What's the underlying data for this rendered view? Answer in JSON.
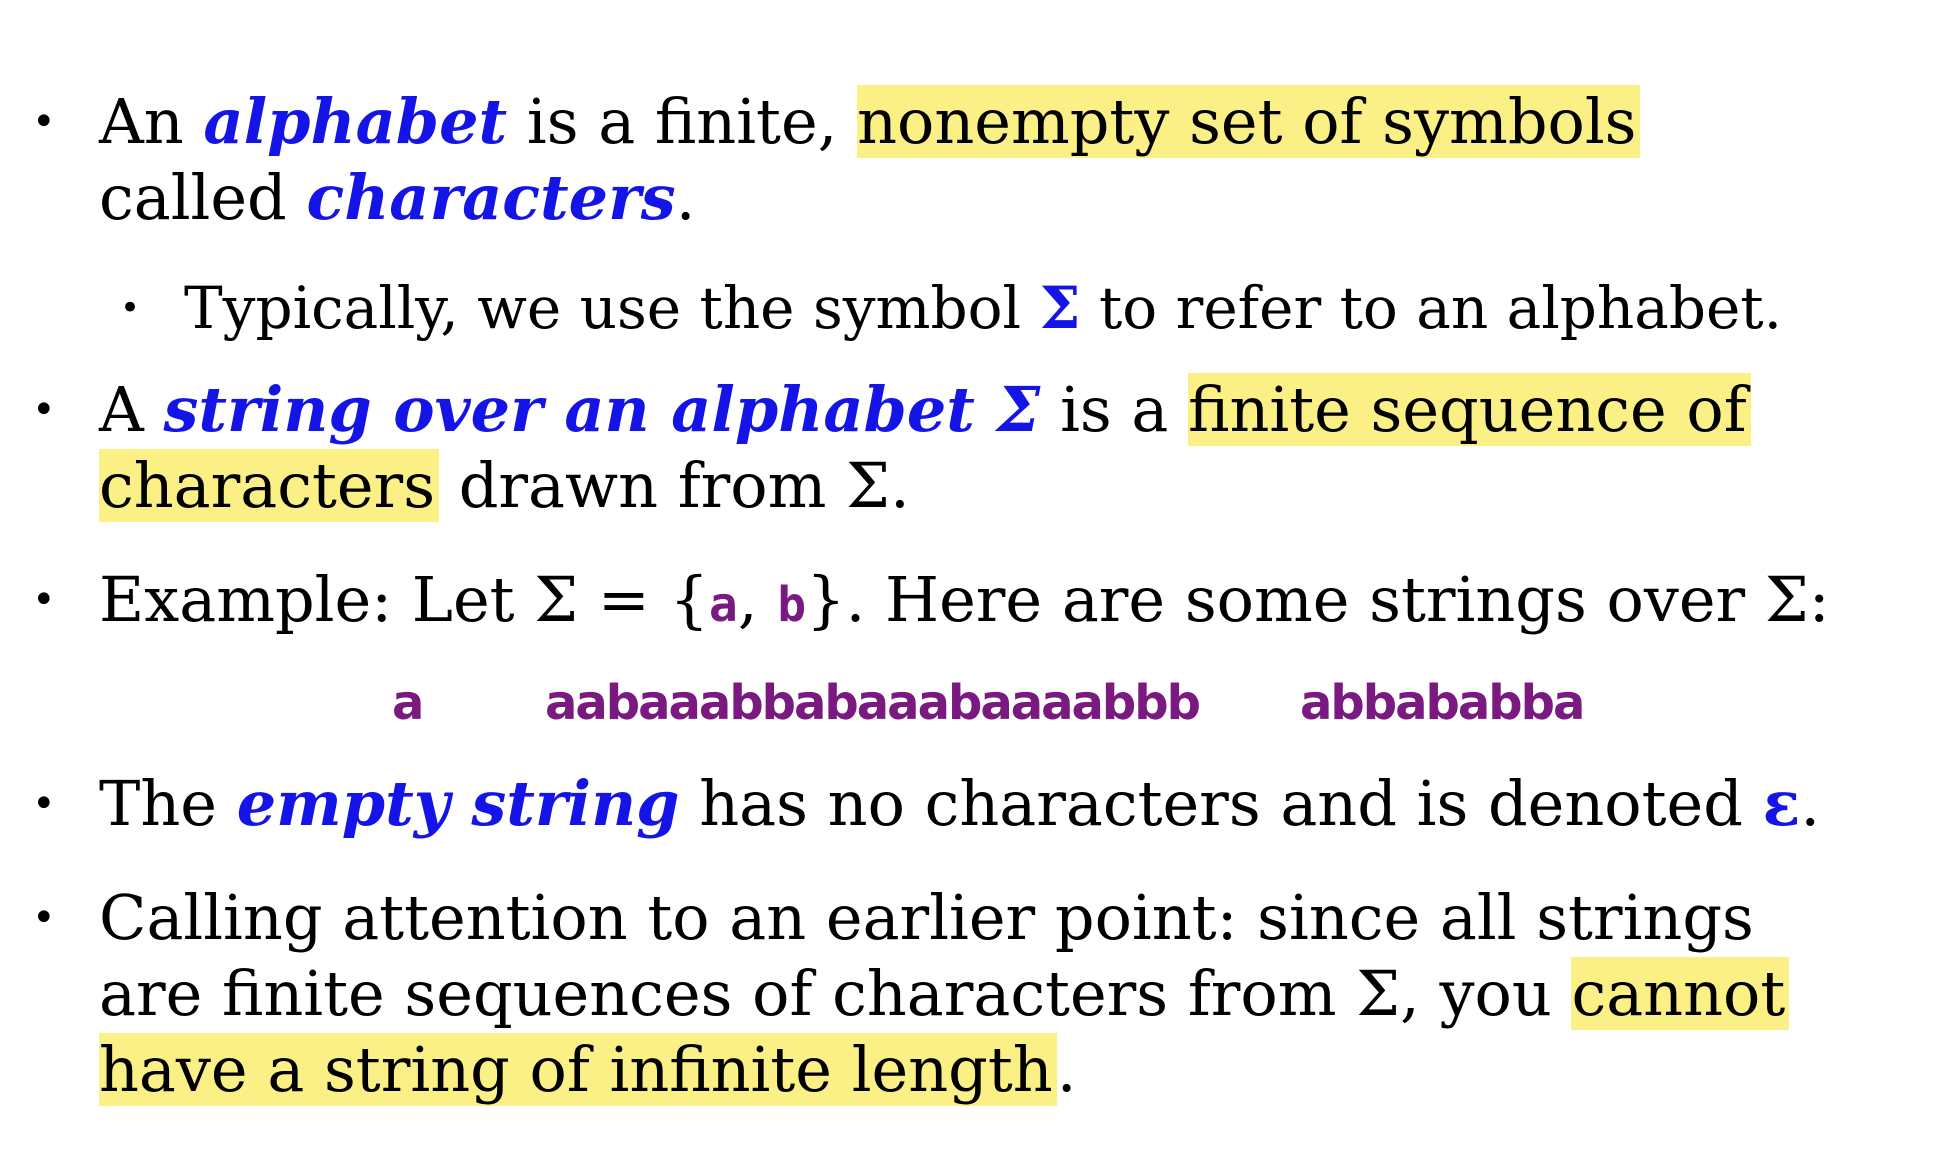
{
  "bullets": {
    "b1": {
      "line1_pre": "An ",
      "term_alphabet": "alphabet",
      "line1_mid": " is a finite, ",
      "line1_hl": "nonempty set of symbols",
      "line2_pre": "called ",
      "term_characters": "characters",
      "line2_post": "."
    },
    "sub1": {
      "pre": "Typically, we use the symbol ",
      "symbol": "Σ",
      "post": " to refer to an alphabet."
    },
    "b2": {
      "line1_pre": "A ",
      "term": "string over an alphabet Σ",
      "line1_mid": " is a ",
      "line1_hl": "finite sequence of",
      "line2_hl": "characters",
      "line2_post": " drawn from Σ."
    },
    "b3": {
      "pre": "Example: Let Σ = {",
      "sym_a": "a",
      "comma": ", ",
      "sym_b": "b",
      "post": "}. Here are some strings over Σ:"
    },
    "examples": [
      "a",
      "aabaaabbabaaabaaaabbb",
      "abbababba"
    ],
    "b4": {
      "pre": "The ",
      "term": "empty string",
      "mid": " has no characters and is denoted ",
      "symbol": "ε",
      "post": "."
    },
    "b5": {
      "line1": "Calling attention to an earlier point: since all strings",
      "line2_pre": "are finite sequences of characters from Σ, you ",
      "line2_hl": "cannot",
      "line3_hl": "have a string of infinite length",
      "line3_post": "."
    }
  },
  "bullet_glyph": "•",
  "colors": {
    "term": "#1414e6",
    "highlight": "#fbf085",
    "symbol": "#7a1a80",
    "text": "#000000"
  }
}
